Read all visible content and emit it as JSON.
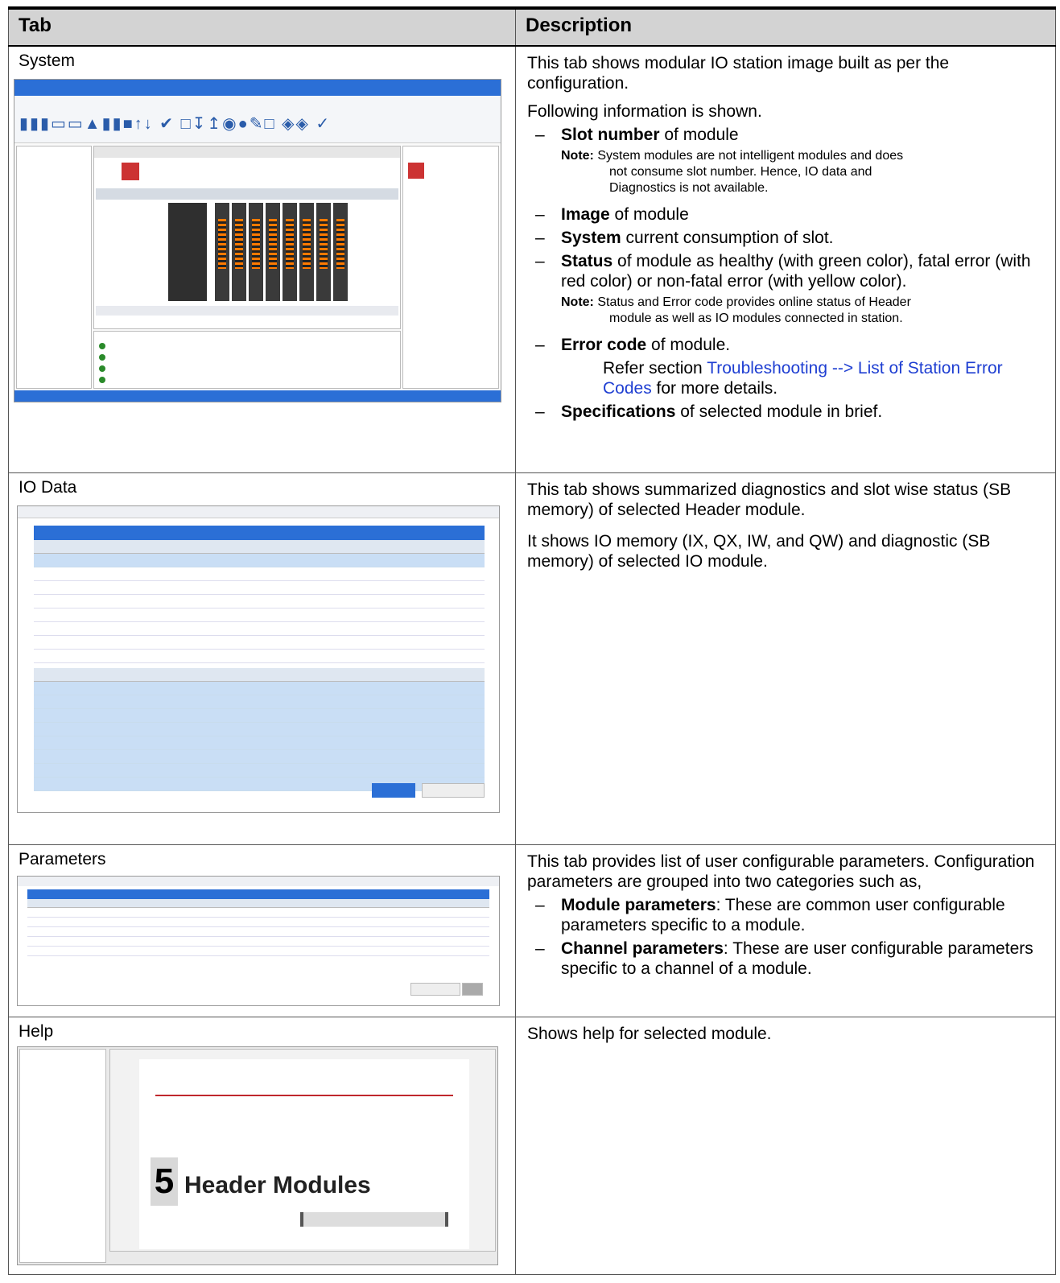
{
  "header": {
    "col1": "Tab",
    "col2": "Description"
  },
  "system": {
    "tab": "System",
    "p1": "This tab shows modular IO station image built as per the configuration.",
    "p2": "Following information is shown.",
    "b1_bold": "Slot number",
    "b1_rest": " of module",
    "note1_label": "Note:",
    "note1_line1": " System modules are not intelligent modules and does",
    "note1_line2": "not consume slot number. Hence, IO data and",
    "note1_line3": "Diagnostics is not available.",
    "b2_bold": "Image",
    "b2_rest": " of module",
    "b3_bold": "System",
    "b3_rest": " current consumption of slot.",
    "b4_bold": "Status",
    "b4_rest": " of module as healthy (with green color), fatal error (with red color) or non-fatal error (with yellow color).",
    "note2_label": "Note:",
    "note2_line1": " Status and Error code provides online status of Header",
    "note2_line2": "module as well as IO modules connected in station.",
    "b5_bold": "Error code",
    "b5_rest": " of module.",
    "ref_pre": "Refer section ",
    "ref_link": "Troubleshooting --> List of Station Error Codes",
    "ref_post": " for more details.",
    "b6_bold": "Specifications",
    "b6_rest": " of selected module in brief."
  },
  "iodata": {
    "tab": "IO Data",
    "p1": "This tab shows summarized diagnostics and slot wise status (SB memory) of selected Header module.",
    "p2": "It shows IO memory (IX, QX, IW, and QW) and diagnostic (SB memory) of selected IO module."
  },
  "parameters": {
    "tab": "Parameters",
    "p1": "This tab provides list of user configurable parameters. Configuration parameters are grouped into two categories such as,",
    "b1_bold": "Module parameters",
    "b1_rest": ": These are common user configurable parameters specific to a module.",
    "b2_bold": "Channel parameters",
    "b2_rest": ": These are user configurable parameters specific to a channel of a module."
  },
  "help": {
    "tab": "Help",
    "p1": "Shows help for selected module.",
    "shot_big_num": "5",
    "shot_heading": "Header Modules"
  },
  "colors": {
    "accent": "#2b6fd6",
    "link": "#1f3fd2",
    "header_bg": "#d3d3d3"
  }
}
